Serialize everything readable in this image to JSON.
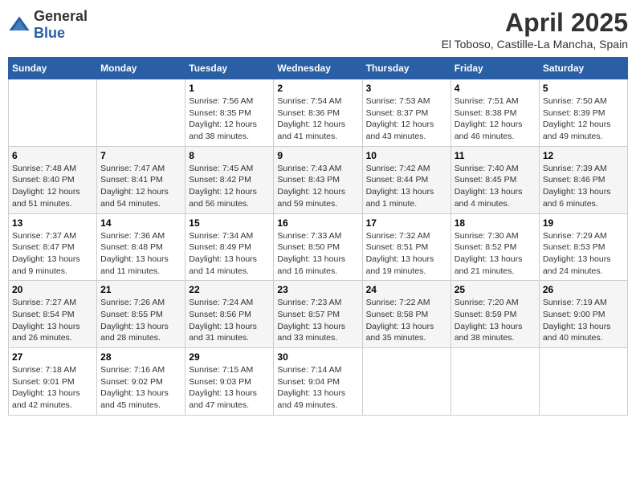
{
  "logo": {
    "general": "General",
    "blue": "Blue"
  },
  "title": "April 2025",
  "subtitle": "El Toboso, Castille-La Mancha, Spain",
  "weekdays": [
    "Sunday",
    "Monday",
    "Tuesday",
    "Wednesday",
    "Thursday",
    "Friday",
    "Saturday"
  ],
  "weeks": [
    [
      {
        "day": "",
        "sunrise": "",
        "sunset": "",
        "daylight": ""
      },
      {
        "day": "",
        "sunrise": "",
        "sunset": "",
        "daylight": ""
      },
      {
        "day": "1",
        "sunrise": "Sunrise: 7:56 AM",
        "sunset": "Sunset: 8:35 PM",
        "daylight": "Daylight: 12 hours and 38 minutes."
      },
      {
        "day": "2",
        "sunrise": "Sunrise: 7:54 AM",
        "sunset": "Sunset: 8:36 PM",
        "daylight": "Daylight: 12 hours and 41 minutes."
      },
      {
        "day": "3",
        "sunrise": "Sunrise: 7:53 AM",
        "sunset": "Sunset: 8:37 PM",
        "daylight": "Daylight: 12 hours and 43 minutes."
      },
      {
        "day": "4",
        "sunrise": "Sunrise: 7:51 AM",
        "sunset": "Sunset: 8:38 PM",
        "daylight": "Daylight: 12 hours and 46 minutes."
      },
      {
        "day": "5",
        "sunrise": "Sunrise: 7:50 AM",
        "sunset": "Sunset: 8:39 PM",
        "daylight": "Daylight: 12 hours and 49 minutes."
      }
    ],
    [
      {
        "day": "6",
        "sunrise": "Sunrise: 7:48 AM",
        "sunset": "Sunset: 8:40 PM",
        "daylight": "Daylight: 12 hours and 51 minutes."
      },
      {
        "day": "7",
        "sunrise": "Sunrise: 7:47 AM",
        "sunset": "Sunset: 8:41 PM",
        "daylight": "Daylight: 12 hours and 54 minutes."
      },
      {
        "day": "8",
        "sunrise": "Sunrise: 7:45 AM",
        "sunset": "Sunset: 8:42 PM",
        "daylight": "Daylight: 12 hours and 56 minutes."
      },
      {
        "day": "9",
        "sunrise": "Sunrise: 7:43 AM",
        "sunset": "Sunset: 8:43 PM",
        "daylight": "Daylight: 12 hours and 59 minutes."
      },
      {
        "day": "10",
        "sunrise": "Sunrise: 7:42 AM",
        "sunset": "Sunset: 8:44 PM",
        "daylight": "Daylight: 13 hours and 1 minute."
      },
      {
        "day": "11",
        "sunrise": "Sunrise: 7:40 AM",
        "sunset": "Sunset: 8:45 PM",
        "daylight": "Daylight: 13 hours and 4 minutes."
      },
      {
        "day": "12",
        "sunrise": "Sunrise: 7:39 AM",
        "sunset": "Sunset: 8:46 PM",
        "daylight": "Daylight: 13 hours and 6 minutes."
      }
    ],
    [
      {
        "day": "13",
        "sunrise": "Sunrise: 7:37 AM",
        "sunset": "Sunset: 8:47 PM",
        "daylight": "Daylight: 13 hours and 9 minutes."
      },
      {
        "day": "14",
        "sunrise": "Sunrise: 7:36 AM",
        "sunset": "Sunset: 8:48 PM",
        "daylight": "Daylight: 13 hours and 11 minutes."
      },
      {
        "day": "15",
        "sunrise": "Sunrise: 7:34 AM",
        "sunset": "Sunset: 8:49 PM",
        "daylight": "Daylight: 13 hours and 14 minutes."
      },
      {
        "day": "16",
        "sunrise": "Sunrise: 7:33 AM",
        "sunset": "Sunset: 8:50 PM",
        "daylight": "Daylight: 13 hours and 16 minutes."
      },
      {
        "day": "17",
        "sunrise": "Sunrise: 7:32 AM",
        "sunset": "Sunset: 8:51 PM",
        "daylight": "Daylight: 13 hours and 19 minutes."
      },
      {
        "day": "18",
        "sunrise": "Sunrise: 7:30 AM",
        "sunset": "Sunset: 8:52 PM",
        "daylight": "Daylight: 13 hours and 21 minutes."
      },
      {
        "day": "19",
        "sunrise": "Sunrise: 7:29 AM",
        "sunset": "Sunset: 8:53 PM",
        "daylight": "Daylight: 13 hours and 24 minutes."
      }
    ],
    [
      {
        "day": "20",
        "sunrise": "Sunrise: 7:27 AM",
        "sunset": "Sunset: 8:54 PM",
        "daylight": "Daylight: 13 hours and 26 minutes."
      },
      {
        "day": "21",
        "sunrise": "Sunrise: 7:26 AM",
        "sunset": "Sunset: 8:55 PM",
        "daylight": "Daylight: 13 hours and 28 minutes."
      },
      {
        "day": "22",
        "sunrise": "Sunrise: 7:24 AM",
        "sunset": "Sunset: 8:56 PM",
        "daylight": "Daylight: 13 hours and 31 minutes."
      },
      {
        "day": "23",
        "sunrise": "Sunrise: 7:23 AM",
        "sunset": "Sunset: 8:57 PM",
        "daylight": "Daylight: 13 hours and 33 minutes."
      },
      {
        "day": "24",
        "sunrise": "Sunrise: 7:22 AM",
        "sunset": "Sunset: 8:58 PM",
        "daylight": "Daylight: 13 hours and 35 minutes."
      },
      {
        "day": "25",
        "sunrise": "Sunrise: 7:20 AM",
        "sunset": "Sunset: 8:59 PM",
        "daylight": "Daylight: 13 hours and 38 minutes."
      },
      {
        "day": "26",
        "sunrise": "Sunrise: 7:19 AM",
        "sunset": "Sunset: 9:00 PM",
        "daylight": "Daylight: 13 hours and 40 minutes."
      }
    ],
    [
      {
        "day": "27",
        "sunrise": "Sunrise: 7:18 AM",
        "sunset": "Sunset: 9:01 PM",
        "daylight": "Daylight: 13 hours and 42 minutes."
      },
      {
        "day": "28",
        "sunrise": "Sunrise: 7:16 AM",
        "sunset": "Sunset: 9:02 PM",
        "daylight": "Daylight: 13 hours and 45 minutes."
      },
      {
        "day": "29",
        "sunrise": "Sunrise: 7:15 AM",
        "sunset": "Sunset: 9:03 PM",
        "daylight": "Daylight: 13 hours and 47 minutes."
      },
      {
        "day": "30",
        "sunrise": "Sunrise: 7:14 AM",
        "sunset": "Sunset: 9:04 PM",
        "daylight": "Daylight: 13 hours and 49 minutes."
      },
      {
        "day": "",
        "sunrise": "",
        "sunset": "",
        "daylight": ""
      },
      {
        "day": "",
        "sunrise": "",
        "sunset": "",
        "daylight": ""
      },
      {
        "day": "",
        "sunrise": "",
        "sunset": "",
        "daylight": ""
      }
    ]
  ]
}
